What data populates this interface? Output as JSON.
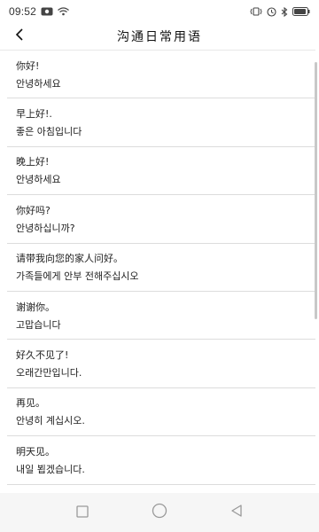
{
  "status_bar": {
    "time": "09:52"
  },
  "header": {
    "title": "沟通日常用语"
  },
  "phrases": [
    {
      "zh": "你好!",
      "ko": "안녕하세요"
    },
    {
      "zh": "早上好!.",
      "ko": "좋은 아침입니다"
    },
    {
      "zh": "晚上好!",
      "ko": "안녕하세요"
    },
    {
      "zh": "你好吗?",
      "ko": "안녕하십니까?"
    },
    {
      "zh": "请带我向您的家人问好。",
      "ko": "가족들에게 안부 전해주십시오"
    },
    {
      "zh": "谢谢你。",
      "ko": "고맙습니다"
    },
    {
      "zh": "好久不见了!",
      "ko": "오래간만입니다."
    },
    {
      "zh": "再见。",
      "ko": "안녕히 계십시오."
    },
    {
      "zh": "明天见。",
      "ko": "내일 뵙겠습니다."
    }
  ],
  "icons": {
    "back": "chevron-left-icon",
    "nav_recents": "square-icon",
    "nav_home": "circle-icon",
    "nav_back": "triangle-left-icon"
  },
  "colors": {
    "background": "#ffffff",
    "divider": "#dcdcdc",
    "nav_bar": "#f6f6f6"
  }
}
